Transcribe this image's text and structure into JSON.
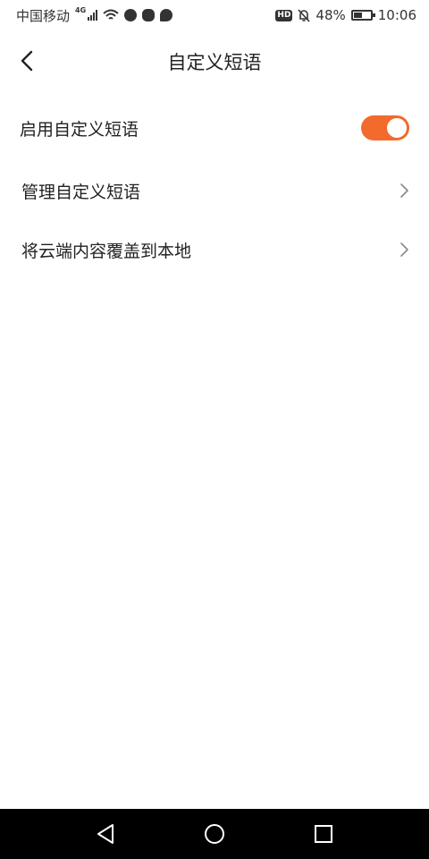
{
  "status_bar": {
    "carrier": "中国移动",
    "network_type": "4G",
    "hd_badge": "HD",
    "battery_percent": "48%",
    "battery_level": 0.48,
    "time": "10:06"
  },
  "header": {
    "title": "自定义短语",
    "back_icon": "chevron-left-icon"
  },
  "settings": {
    "enable_label": "启用自定义短语",
    "enable_on": true,
    "manage_label": "管理自定义短语",
    "overwrite_label": "将云端内容覆盖到本地"
  },
  "colors": {
    "accent": "#f26b2d"
  },
  "system_nav": {
    "icons": [
      "back-triangle-icon",
      "home-circle-icon",
      "recents-square-icon"
    ]
  }
}
